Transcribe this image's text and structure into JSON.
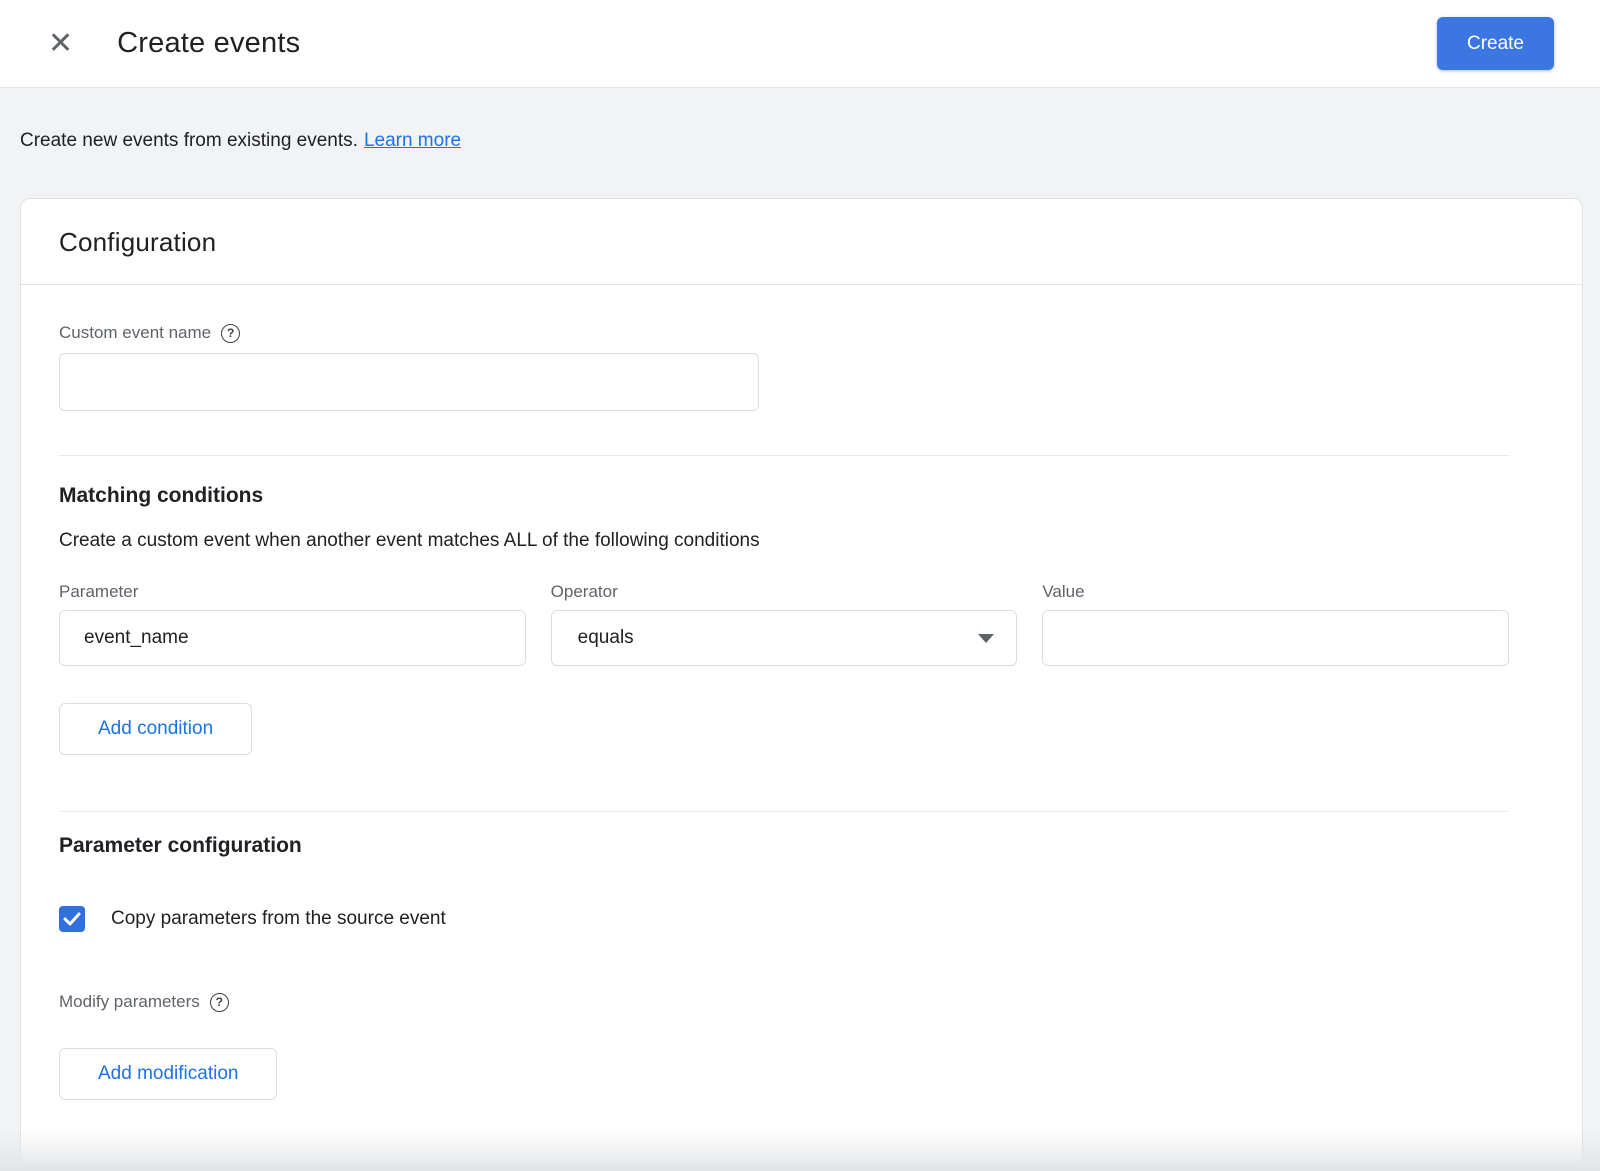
{
  "header": {
    "title": "Create events",
    "create_button_label": "Create"
  },
  "icons": {
    "close": "✕",
    "help": "?"
  },
  "intro": {
    "text": "Create new events from existing events.",
    "link_label": "Learn more"
  },
  "card": {
    "section_title": "Configuration",
    "custom_event_name": {
      "label": "Custom event name",
      "value": ""
    },
    "matching_conditions": {
      "title": "Matching conditions",
      "description": "Create a custom event when another event matches ALL of the following conditions",
      "condition": {
        "parameter_label": "Parameter",
        "parameter_value": "event_name",
        "operator_label": "Operator",
        "operator_value": "equals",
        "value_label": "Value",
        "value_value": ""
      },
      "add_condition_label": "Add condition"
    },
    "parameter_configuration": {
      "title": "Parameter configuration",
      "copy_checkbox_label": "Copy parameters from the source event",
      "copy_checkbox_checked": true,
      "modify_parameters_label": "Modify parameters",
      "add_modification_label": "Add modification"
    }
  },
  "colors": {
    "accent_blue": "#3b76e1",
    "link_blue": "#1a73e8",
    "checkbox_blue": "#3170df",
    "text_primary": "#202124",
    "text_secondary": "#5f6368",
    "border": "#dadce0",
    "page_background": "#f1f3f4"
  }
}
